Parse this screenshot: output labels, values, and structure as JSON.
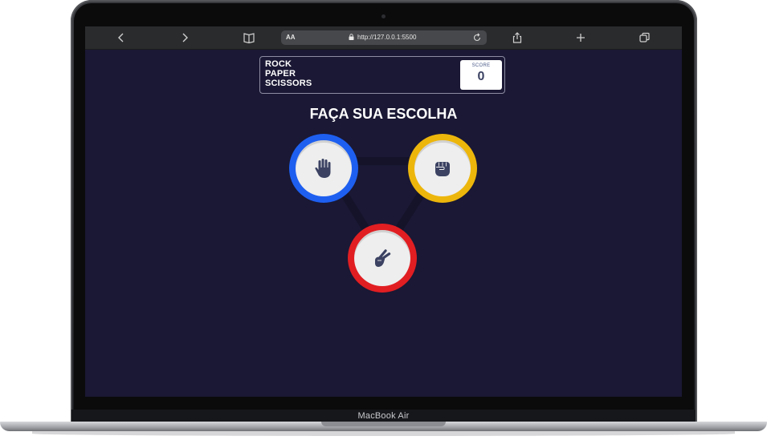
{
  "device": {
    "model_label": "MacBook Air"
  },
  "browser": {
    "reader_icon": "text-size-icon",
    "reader_label": "AA",
    "url": "http://127.0.0.1:5500",
    "toolbar_icons": [
      "back-icon",
      "forward-icon",
      "bookmarks-icon",
      "lock-icon",
      "reload-icon",
      "share-icon",
      "new-tab-icon",
      "tabs-icon"
    ]
  },
  "game": {
    "title_lines": [
      "ROCK",
      "PAPER",
      "SCISSORS"
    ],
    "score_label": "SCORE",
    "score_value": "0",
    "prompt": "FAÇA SUA ESCOLHA",
    "choices": [
      {
        "name": "paper",
        "icon": "hand-icon",
        "color": "#1e5ff0"
      },
      {
        "name": "rock",
        "icon": "fist-icon",
        "color": "#edb60b"
      },
      {
        "name": "scissors",
        "icon": "peace-hand-icon",
        "color": "#e11e22"
      }
    ],
    "colors": {
      "background": "#1a1834",
      "icon": "#3b4262"
    }
  }
}
